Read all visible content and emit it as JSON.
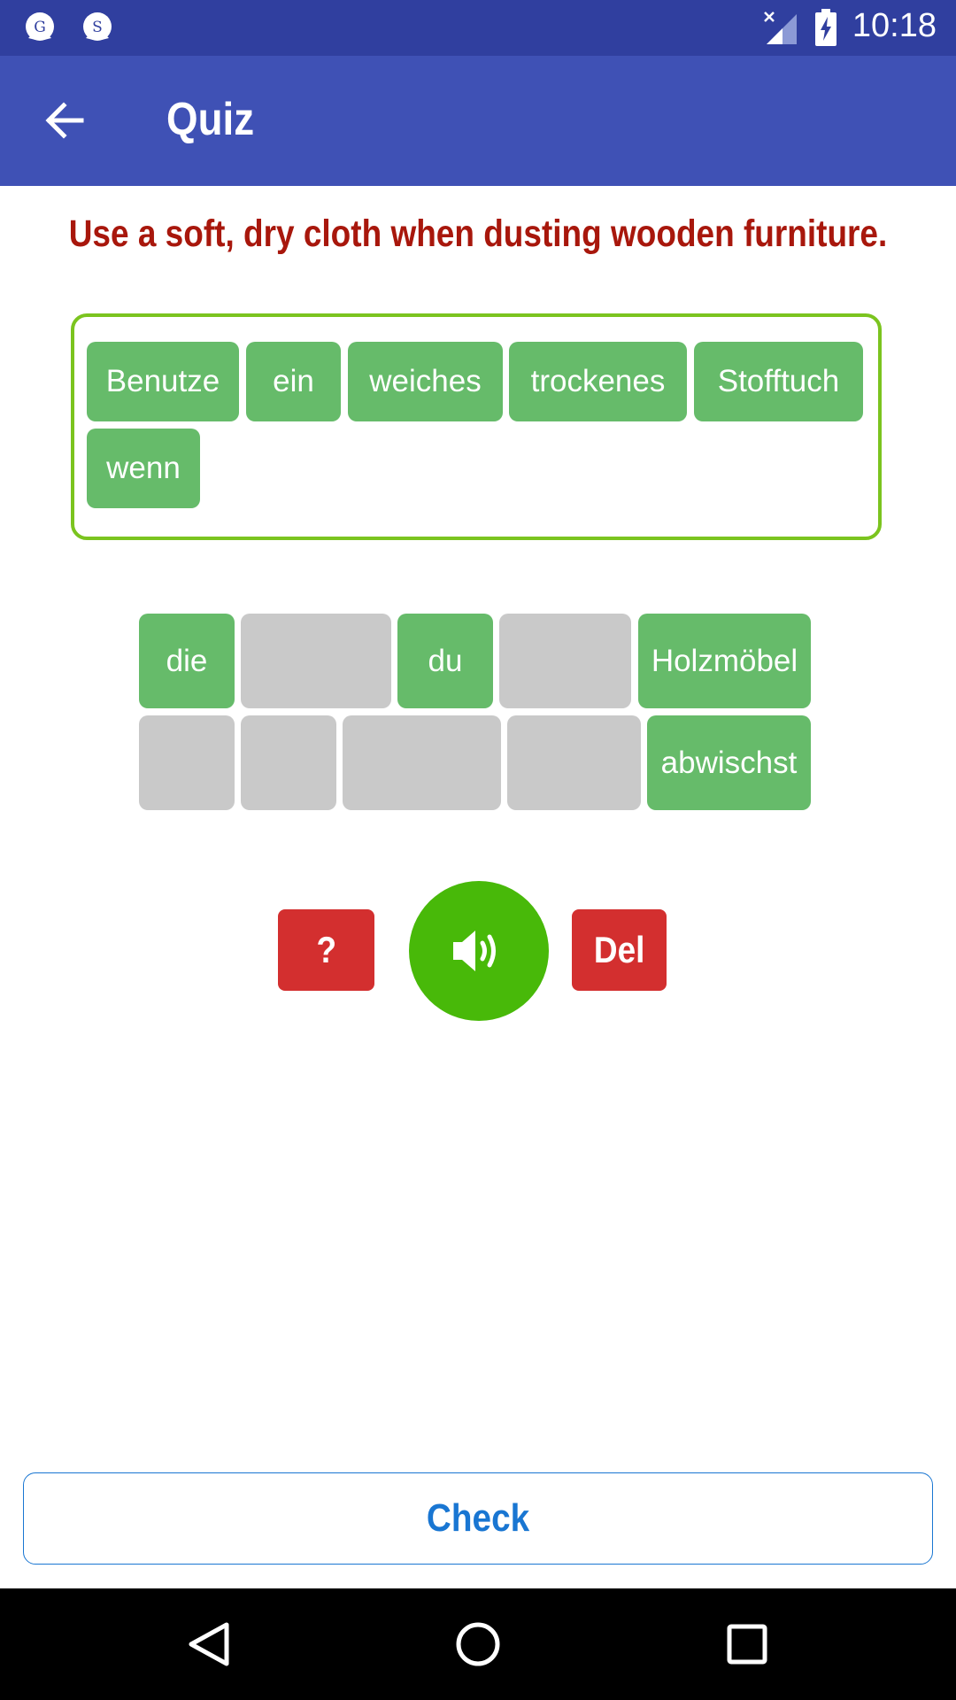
{
  "status_bar": {
    "time": "10:18",
    "notification_icons": [
      "G",
      "S"
    ]
  },
  "app_bar": {
    "title": "Quiz",
    "back_icon": "arrow-back-icon"
  },
  "prompt": "Use a soft, dry cloth when dusting wooden furniture.",
  "answer_words": [
    "Benutze",
    "ein",
    "weiches",
    "trockenes",
    "Stofftuch",
    "wenn"
  ],
  "word_bank": [
    {
      "word": "die",
      "used": false
    },
    {
      "word": "",
      "used": true
    },
    {
      "word": "du",
      "used": false
    },
    {
      "word": "",
      "used": true
    },
    {
      "word": "Holzmöbel",
      "used": false
    },
    {
      "word": "",
      "used": true
    },
    {
      "word": "",
      "used": true
    },
    {
      "word": "",
      "used": true
    },
    {
      "word": "",
      "used": true
    },
    {
      "word": "abwischst",
      "used": false
    }
  ],
  "buttons": {
    "hint": "?",
    "delete": "Del",
    "check": "Check",
    "speaker_icon": "speaker-icon"
  },
  "colors": {
    "app_bar": "#3f51b5",
    "status_bar": "#303f9f",
    "prompt": "#a8170c",
    "tile": "#66bb6a",
    "slot_empty": "#c9c9c9",
    "answer_border": "#7bc41f",
    "red_button": "#d32f2f",
    "speaker": "#48b909",
    "check": "#1976d2"
  }
}
